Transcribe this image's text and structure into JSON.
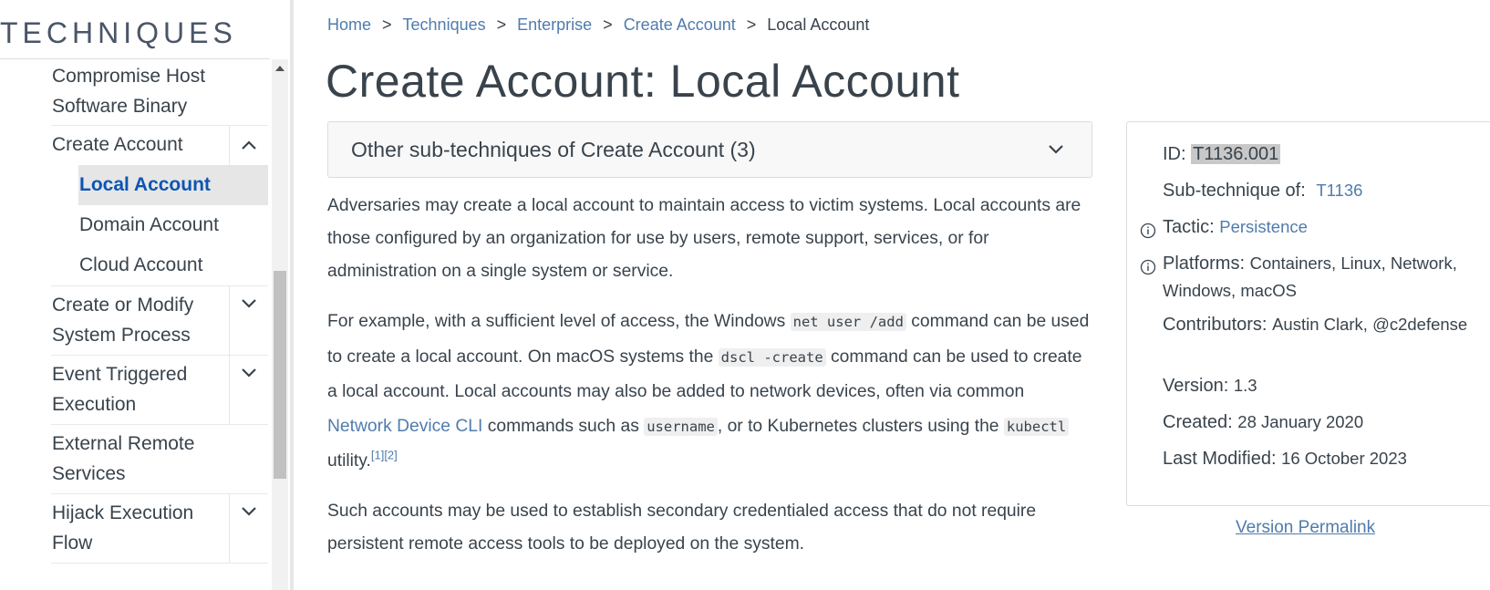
{
  "sidebar": {
    "title": "TECHNIQUES",
    "items": [
      {
        "label": "Compromise Host Software Binary",
        "level": 1,
        "has_toggle": false
      },
      {
        "label": "Create Account",
        "level": 1,
        "has_toggle": true,
        "expanded": true
      },
      {
        "label": "Local Account",
        "level": 2,
        "active": true
      },
      {
        "label": "Domain Account",
        "level": 2
      },
      {
        "label": "Cloud Account",
        "level": 2
      },
      {
        "label": "Create or Modify System Process",
        "level": 1,
        "has_toggle": true
      },
      {
        "label": "Event Triggered Execution",
        "level": 1,
        "has_toggle": true
      },
      {
        "label": "External Remote Services",
        "level": 1,
        "has_toggle": false
      },
      {
        "label": "Hijack Execution Flow",
        "level": 1,
        "has_toggle": true
      }
    ]
  },
  "breadcrumb": {
    "items": [
      "Home",
      "Techniques",
      "Enterprise",
      "Create Account"
    ],
    "current": "Local Account",
    "separator": ">"
  },
  "page": {
    "title": "Create Account: Local Account"
  },
  "subtechniques": {
    "label": "Other sub-techniques of Create Account (3)"
  },
  "description": {
    "p1": "Adversaries may create a local account to maintain access to victim systems. Local accounts are those configured by an organization for use by users, remote support, services, or for administration on a single system or service.",
    "p2": {
      "t1": "For example, with a sufficient level of access, the Windows ",
      "c1": "net user /add",
      "t2": " command can be used to create a local account. On macOS systems the ",
      "c2": "dscl -create",
      "t3": " command can be used to create a local account. Local accounts may also be added to network devices, often via common ",
      "link": "Network Device CLI",
      "t4": " commands such as ",
      "c3": "username",
      "t5": ", or to Kubernetes clusters using the ",
      "c4": "kubectl",
      "t6": " utility.",
      "refs": "[1][2]"
    },
    "p3": "Such accounts may be used to establish secondary credentialed access that do not require persistent remote access tools to be deployed on the system."
  },
  "card": {
    "id_label": "ID:",
    "id_value": "T1136.001",
    "subtech_label": "Sub-technique of:",
    "subtech_value": "T1136",
    "tactic_label": "Tactic:",
    "tactic_value": "Persistence",
    "platforms_label": "Platforms:",
    "platforms_value": "Containers, Linux, Network, Windows, macOS",
    "contributors_label": "Contributors:",
    "contributors_value": "Austin Clark, @c2defense",
    "version_label": "Version:",
    "version_value": "1.3",
    "created_label": "Created:",
    "created_value": "28 January 2020",
    "modified_label": "Last Modified:",
    "modified_value": "16 October 2023"
  },
  "version_permalink": "Version Permalink",
  "colors": {
    "link": "#4f7cac",
    "active_nav": "#0b55b4",
    "text": "#39434c"
  },
  "icons": [
    "chevron-up-icon",
    "chevron-down-icon",
    "info-icon",
    "scroll-up-arrow-icon"
  ]
}
